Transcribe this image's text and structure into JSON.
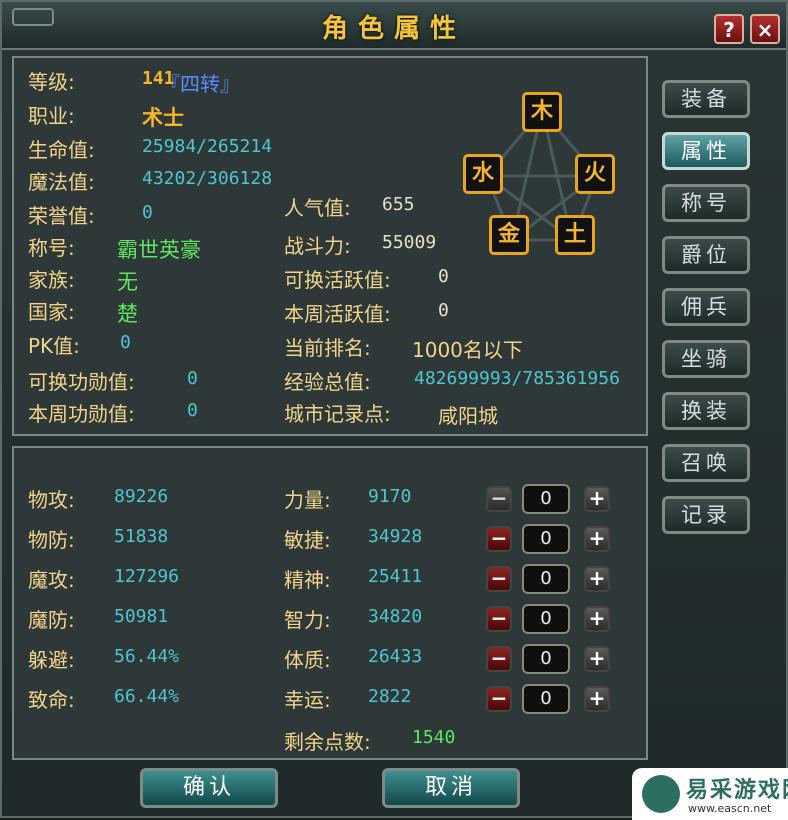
{
  "window": {
    "title": "角色属性"
  },
  "profile": [
    {
      "label": "等级:",
      "value": "141",
      "extra": "『四转』"
    },
    {
      "label": "职业:",
      "value": "术士"
    },
    {
      "label": "生命值:",
      "value": "25984/265214"
    },
    {
      "label": "魔法值:",
      "value": "43202/306128"
    },
    {
      "label": "荣誉值:",
      "value": "0"
    },
    {
      "label": "称号:",
      "value": "霸世英豪"
    },
    {
      "label": "家族:",
      "value": "无"
    },
    {
      "label": "国家:",
      "value": "楚"
    },
    {
      "label": "PK值:",
      "value": "0"
    },
    {
      "label": "可换功勋值:",
      "value": "0"
    },
    {
      "label": "本周功勋值:",
      "value": "0"
    }
  ],
  "social": [
    {
      "label": "人气值:",
      "value": "655"
    },
    {
      "label": "战斗力:",
      "value": "55009"
    },
    {
      "label": "可换活跃值:",
      "value": "0"
    },
    {
      "label": "本周活跃值:",
      "value": "0"
    },
    {
      "label": "当前排名:",
      "value": "1000名以下"
    },
    {
      "label": "经验总值:",
      "value": "482699993/785361956"
    },
    {
      "label": "城市记录点:",
      "value": "咸阳城"
    }
  ],
  "elements": [
    "木",
    "火",
    "土",
    "金",
    "水"
  ],
  "combat": [
    {
      "label": "物攻:",
      "value": "89226"
    },
    {
      "label": "物防:",
      "value": "51838"
    },
    {
      "label": "魔攻:",
      "value": "127296"
    },
    {
      "label": "魔防:",
      "value": "50981"
    },
    {
      "label": "躲避:",
      "value": "56.44%"
    },
    {
      "label": "致命:",
      "value": "66.44%"
    }
  ],
  "attributes": [
    {
      "label": "力量:",
      "value": "9170",
      "points": "0"
    },
    {
      "label": "敏捷:",
      "value": "34928",
      "points": "0"
    },
    {
      "label": "精神:",
      "value": "25411",
      "points": "0"
    },
    {
      "label": "智力:",
      "value": "34820",
      "points": "0"
    },
    {
      "label": "体质:",
      "value": "26433",
      "points": "0"
    },
    {
      "label": "幸运:",
      "value": "2822",
      "points": "0"
    }
  ],
  "remaining": {
    "label": "剩余点数:",
    "value": "1540"
  },
  "tabs": [
    "装备",
    "属性",
    "称号",
    "爵位",
    "佣兵",
    "坐骑",
    "换装",
    "召唤",
    "记录"
  ],
  "active_tab": "属性",
  "buttons": {
    "confirm": "确认",
    "cancel": "取消",
    "help": "?",
    "close": "×",
    "minus": "−",
    "plus": "+"
  },
  "watermark": {
    "name": "易采游戏网",
    "url": "www.eascn.net"
  },
  "colors": {
    "label": "#f1d48a",
    "value": "#4fc6cf",
    "gold": "#f6b52a",
    "green": "#5fe65f",
    "accent": "#3e8f90"
  }
}
